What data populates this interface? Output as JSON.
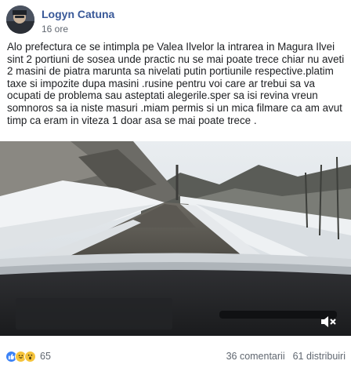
{
  "post": {
    "author": "Logyn Catuna",
    "time": "16 ore",
    "text": "Alo prefectura ce se intimpla pe Valea Ilvelor la intrarea in Magura Ilvei sint 2 portiuni de sosea unde practic nu se mai poate trece chiar nu aveti 2 masini de piatra marunta sa nivelati putin portiunile respective.platim taxe si impozite dupa masini .rusine pentru voi care ar trebui sa va ocupati de problema sau asteptati alegerile.sper sa isi revina vreun somnoros sa ia niste masuri .miam permis si un mica filmare ca am avut timp ca eram in viteza 1 doar asa se mai poate trece ."
  },
  "footer": {
    "reaction_count": "65",
    "comments": "36 comentarii",
    "shares": "61 distribuiri"
  },
  "icons": {
    "reactions": [
      "like-icon",
      "haha-icon",
      "wow-icon"
    ],
    "video": [
      "mute-icon"
    ]
  },
  "colors": {
    "author_link": "#385898",
    "secondary_text": "#606770",
    "like_blue": "#3b82f6"
  }
}
